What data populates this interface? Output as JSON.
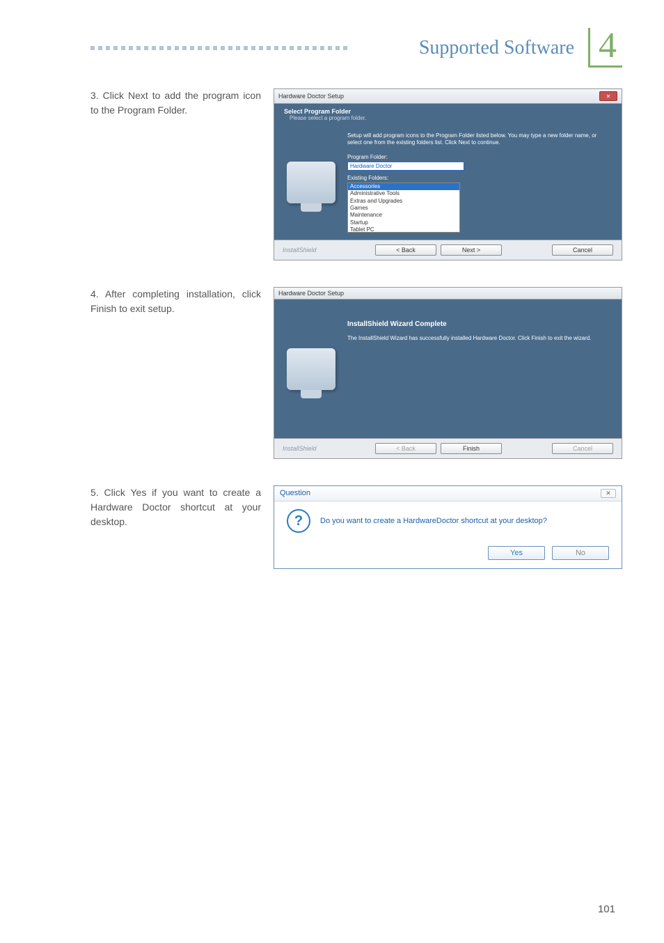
{
  "header": {
    "title": "Supported Software",
    "chapter": "4"
  },
  "steps": [
    {
      "num": "3.",
      "text": "Click Next to add the program icon to the Program Folder."
    },
    {
      "num": "4.",
      "text": "After completing installation, click Finish to exit setup."
    },
    {
      "num": "5.",
      "text": "Click Yes if you want to create a Hardware Doctor shortcut at your desktop."
    }
  ],
  "dialog1": {
    "title": "Hardware Doctor Setup",
    "heading": "Select Program Folder",
    "subheading": "Please select a program folder.",
    "note": "Setup will add program icons to the Program Folder listed below. You may type a new folder name, or select one from the existing folders list. Click Next to continue.",
    "pf_label": "Program Folder:",
    "pf_value": "Hardware Doctor",
    "ef_label": "Existing Folders:",
    "folders": [
      "Accessories",
      "Administrative Tools",
      "Extras and Upgrades",
      "Games",
      "Maintenance",
      "Startup",
      "Tablet PC"
    ],
    "brand": "InstallShield",
    "back": "< Back",
    "next": "Next >",
    "cancel": "Cancel"
  },
  "dialog2": {
    "title": "Hardware Doctor Setup",
    "heading": "InstallShield Wizard Complete",
    "note": "The InstallShield Wizard has successfully installed Hardware Doctor. Click Finish to exit the wizard.",
    "brand": "InstallShield",
    "back": "< Back",
    "finish": "Finish",
    "cancel": "Cancel"
  },
  "dialog3": {
    "title": "Question",
    "msg": "Do you want to create a HardwareDoctor shortcut at your desktop?",
    "yes": "Yes",
    "no": "No"
  },
  "page_number": "101"
}
